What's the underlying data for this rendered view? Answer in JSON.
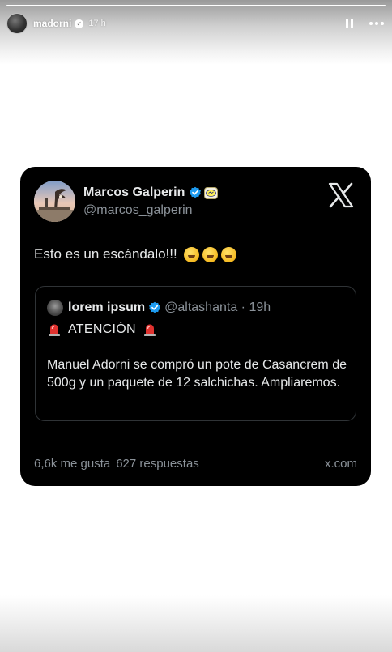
{
  "story": {
    "username": "madorni",
    "time_ago": "17 h",
    "progress_fraction": 1.0
  },
  "tweet": {
    "author_name": "Marcos Galperin",
    "author_handle": "@marcos_galperin",
    "text": "Esto es un escándalo!!!",
    "laugh_emoji_count": 3,
    "quoted": {
      "name": "lorem ipsum",
      "handle_time": "@altashanta · 19h",
      "alert": "ATENCIÓN",
      "body": "Manuel Adorni se compró un pote de Casancrem de 500g y un paquete de 12 salchichas. Ampliaremos."
    },
    "likes": "6,6k me gusta",
    "replies": "627 respuestas",
    "source": "x.com"
  },
  "colors": {
    "card_bg": "#000000",
    "verified_blue": "#1d9bf0",
    "muted_text": "#8b9299",
    "siren_red": "#e0322f"
  }
}
